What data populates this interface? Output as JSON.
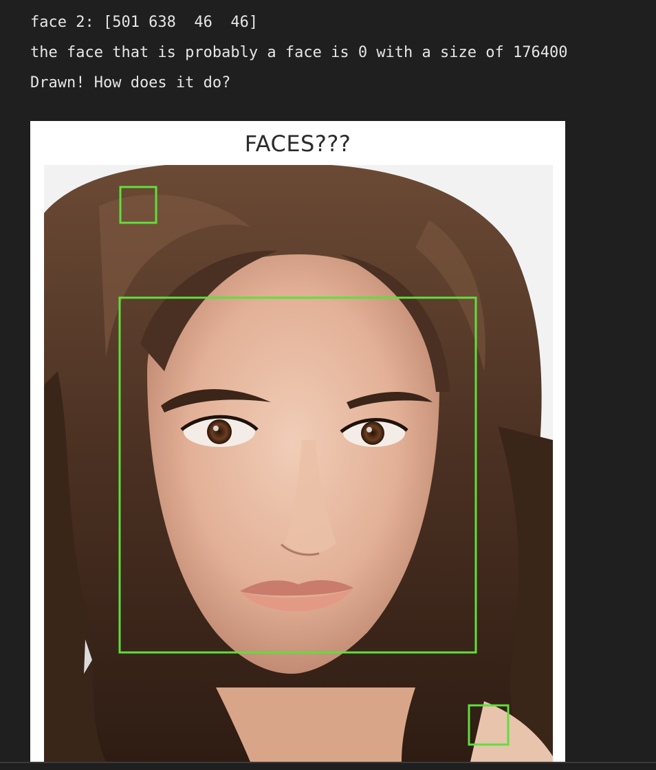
{
  "console": {
    "line1": "face 2: [501 638  46  46]",
    "line2": "the face that is probably a face is 0 with a size of 176400",
    "line3": "Drawn! How does it do?"
  },
  "figure": {
    "title": "FACES???",
    "box_color": "#5ee03b"
  }
}
